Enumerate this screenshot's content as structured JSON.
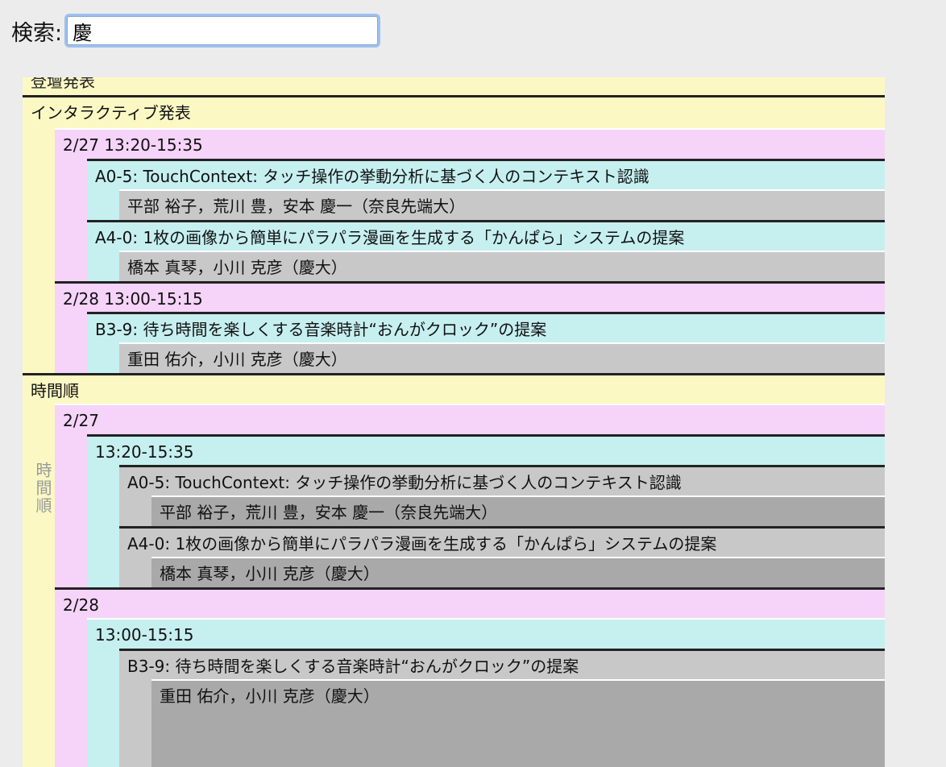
{
  "search": {
    "label": "検索:",
    "value": "慶"
  },
  "tree": {
    "cut_heading": "登壇発表",
    "interactive": {
      "heading": "インタラクティブ発表",
      "sessions": [
        {
          "time": "2/27 13:20-15:35",
          "papers": [
            {
              "title": "A0-5: TouchContext: タッチ操作の挙動分析に基づく人のコンテキスト認識",
              "authors": "平部 裕子，荒川 豊，安本 慶一（奈良先端大）"
            },
            {
              "title": "A4-0: 1枚の画像から簡単にパラパラ漫画を生成する「かんぱら」システムの提案",
              "authors": "橋本 真琴，小川 克彦（慶大）"
            }
          ]
        },
        {
          "time": "2/28 13:00-15:15",
          "papers": [
            {
              "title": "B3-9: 待ち時間を楽しくする音楽時計“おんがクロック”の提案",
              "authors": "重田 佑介，小川 克彦（慶大）"
            }
          ]
        }
      ]
    },
    "chronological": {
      "heading": "時間順",
      "side_label": "時間順",
      "days": [
        {
          "date": "2/27",
          "slots": [
            {
              "time": "13:20-15:35",
              "papers": [
                {
                  "title": "A0-5: TouchContext: タッチ操作の挙動分析に基づく人のコンテキスト認識",
                  "authors": "平部 裕子，荒川 豊，安本 慶一（奈良先端大）"
                },
                {
                  "title": "A4-0: 1枚の画像から簡単にパラパラ漫画を生成する「かんぱら」システムの提案",
                  "authors": "橋本 真琴，小川 克彦（慶大）"
                }
              ]
            }
          ]
        },
        {
          "date": "2/28",
          "slots": [
            {
              "time": "13:00-15:15",
              "papers": [
                {
                  "title": "B3-9: 待ち時間を楽しくする音楽時計“おんがクロック”の提案",
                  "authors": "重田 佑介，小川 克彦（慶大）"
                }
              ]
            }
          ]
        }
      ]
    }
  }
}
